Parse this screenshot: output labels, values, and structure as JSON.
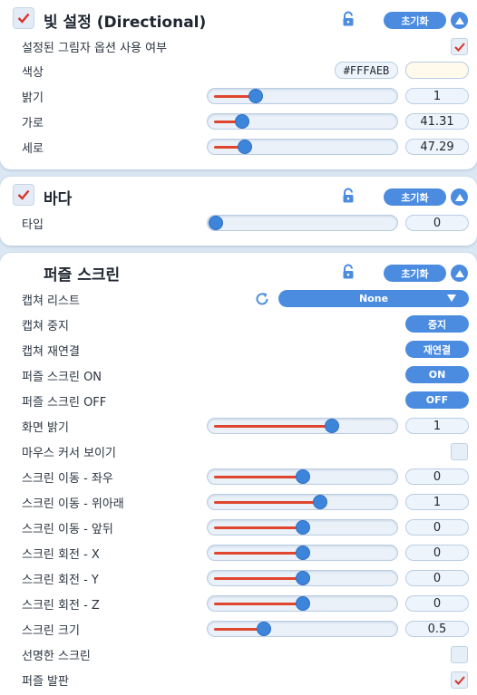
{
  "colors": {
    "accent": "#4b8ce0",
    "check": "#d9342b",
    "slider_fill": "#e0462e",
    "swatch": "#FFFAEB"
  },
  "panels": {
    "light": {
      "title": "빛 설정 (Directional)",
      "reset_label": "초기화",
      "use_shadow_label": "설정된 그림자 옵션 사용 여부",
      "use_shadow_checked": true,
      "color_label": "색상",
      "color_hex": "#FFFAEB",
      "brightness_label": "밝기",
      "brightness_value": "1",
      "brightness_level": 0.23,
      "horizontal_label": "가로",
      "horizontal_value": "41.31",
      "horizontal_level": 0.15,
      "vertical_label": "세로",
      "vertical_value": "47.29",
      "vertical_level": 0.17
    },
    "floor": {
      "title": "바다",
      "reset_label": "초기화",
      "type_label": "타입",
      "type_value": "0",
      "type_level": 0.0
    },
    "puzzle": {
      "title": "퍼즐 스크린",
      "reset_label": "초기화",
      "capture_list_label": "캡쳐 리스트",
      "capture_list_value": "None",
      "capture_stop_label": "캡쳐 중지",
      "capture_stop_btn": "중지",
      "capture_reconnect_label": "캡쳐 재연결",
      "capture_reconnect_btn": "재연결",
      "screen_on_label": "퍼즐 스크린 ON",
      "screen_on_btn": "ON",
      "screen_off_label": "퍼즐 스크린 OFF",
      "screen_off_btn": "OFF",
      "screen_brightness_label": "화면 밝기",
      "screen_brightness_value": "1",
      "screen_brightness_level": 0.67,
      "mouse_cursor_label": "마우스 커서 보이기",
      "mouse_cursor_checked": false,
      "move_lr_label": "스크린 이동 - 좌우",
      "move_lr_value": "0",
      "move_lr_level": 0.5,
      "move_ud_label": "스크린 이동 - 위아래",
      "move_ud_value": "1",
      "move_ud_level": 0.6,
      "move_fb_label": "스크린 이동 - 앞뒤",
      "move_fb_value": "0",
      "move_fb_level": 0.5,
      "rot_x_label": "스크린 회전 - X",
      "rot_x_value": "0",
      "rot_x_level": 0.5,
      "rot_y_label": "스크린 회전 - Y",
      "rot_y_value": "0",
      "rot_y_level": 0.5,
      "rot_z_label": "스크린 회전 - Z",
      "rot_z_value": "0",
      "rot_z_level": 0.5,
      "scale_label": "스크린 크기",
      "scale_value": "0.5",
      "scale_level": 0.28,
      "sharp_label": "선명한 스크린",
      "sharp_checked": false,
      "puzzle_board_label": "퍼즐 발판",
      "puzzle_board_checked": true
    }
  }
}
